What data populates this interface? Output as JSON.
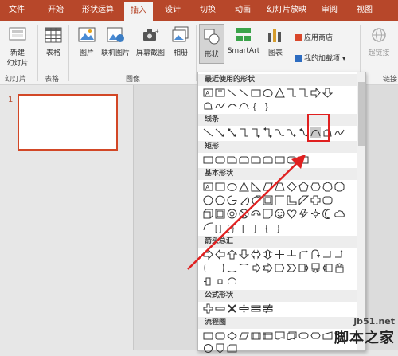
{
  "tabs": [
    "文件",
    "开始",
    "形状运算",
    "插入",
    "设计",
    "切换",
    "动画",
    "幻灯片放映",
    "审阅",
    "视图"
  ],
  "ribbon": {
    "new_slide": "新建\n幻灯片",
    "table": "表格",
    "picture": "图片",
    "online_picture": "联机图片",
    "screenshot": "屏幕截图",
    "album": "相册",
    "shapes": "形状",
    "smartart": "SmartArt",
    "chart": "图表",
    "app_store": "应用商店",
    "my_addins": "我的加载项",
    "hyperlink": "超链接",
    "groups": {
      "slides": "幻灯片",
      "tables": "表格",
      "images": "图像",
      "links": "链接"
    }
  },
  "slide_panel": {
    "slide_number": "1"
  },
  "dropdown": {
    "sections": [
      "最近使用的形状",
      "线条",
      "矩形",
      "基本形状",
      "箭头总汇",
      "公式形状",
      "流程图"
    ]
  },
  "watermark": {
    "site": "jb51.net",
    "brand": "脚本之家"
  },
  "colors": {
    "accent": "#b7472a",
    "highlight": "#e02020"
  }
}
